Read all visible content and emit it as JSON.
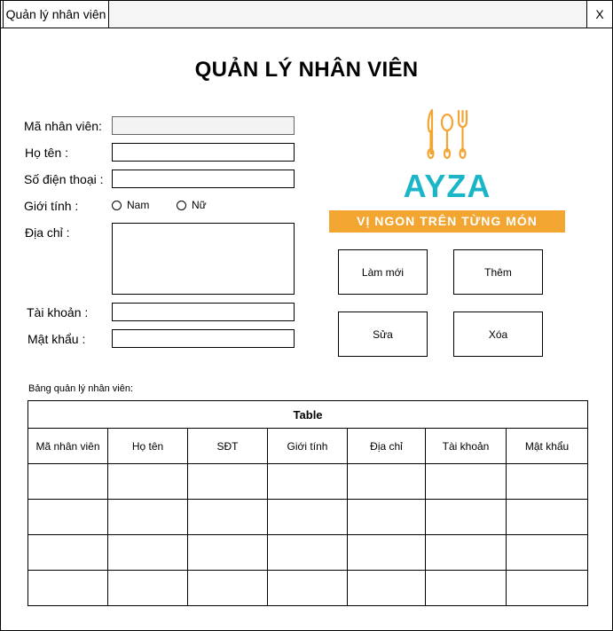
{
  "window": {
    "tab_title": "Quản lý nhân viên",
    "close_label": "X"
  },
  "page_title": "QUẢN LÝ NHÂN VIÊN",
  "form": {
    "employee_id_label": "Mã nhân viên:",
    "employee_id_value": "",
    "name_label": "Họ tên :",
    "name_value": "",
    "phone_label": "Số điện thoại :",
    "phone_value": "",
    "gender_label": "Giới tính :",
    "gender_male": "Nam",
    "gender_female": "Nữ",
    "address_label": "Địa chỉ :",
    "address_value": "",
    "account_label": "Tài khoản :",
    "account_value": "",
    "password_label": "Mật khẩu :",
    "password_value": ""
  },
  "logo": {
    "brand": "AYZA",
    "slogan": "VỊ NGON TRÊN TỪNG MÓN",
    "icon_color": "#f2a531",
    "brand_color": "#1ab6c7"
  },
  "buttons": {
    "refresh": "Làm mới",
    "add": "Thêm",
    "edit": "Sửa",
    "delete": "Xóa"
  },
  "table": {
    "caption_label": "Bảng quản lý nhân viên:",
    "title": "Table",
    "columns": [
      "Mã nhân viên",
      "Họ tên",
      "SĐT",
      "Giới tính",
      "Địa chỉ",
      "Tài khoản",
      "Mật khẩu"
    ],
    "rows": [
      [
        "",
        "",
        "",
        "",
        "",
        "",
        ""
      ],
      [
        "",
        "",
        "",
        "",
        "",
        "",
        ""
      ],
      [
        "",
        "",
        "",
        "",
        "",
        "",
        ""
      ],
      [
        "",
        "",
        "",
        "",
        "",
        "",
        ""
      ]
    ]
  }
}
